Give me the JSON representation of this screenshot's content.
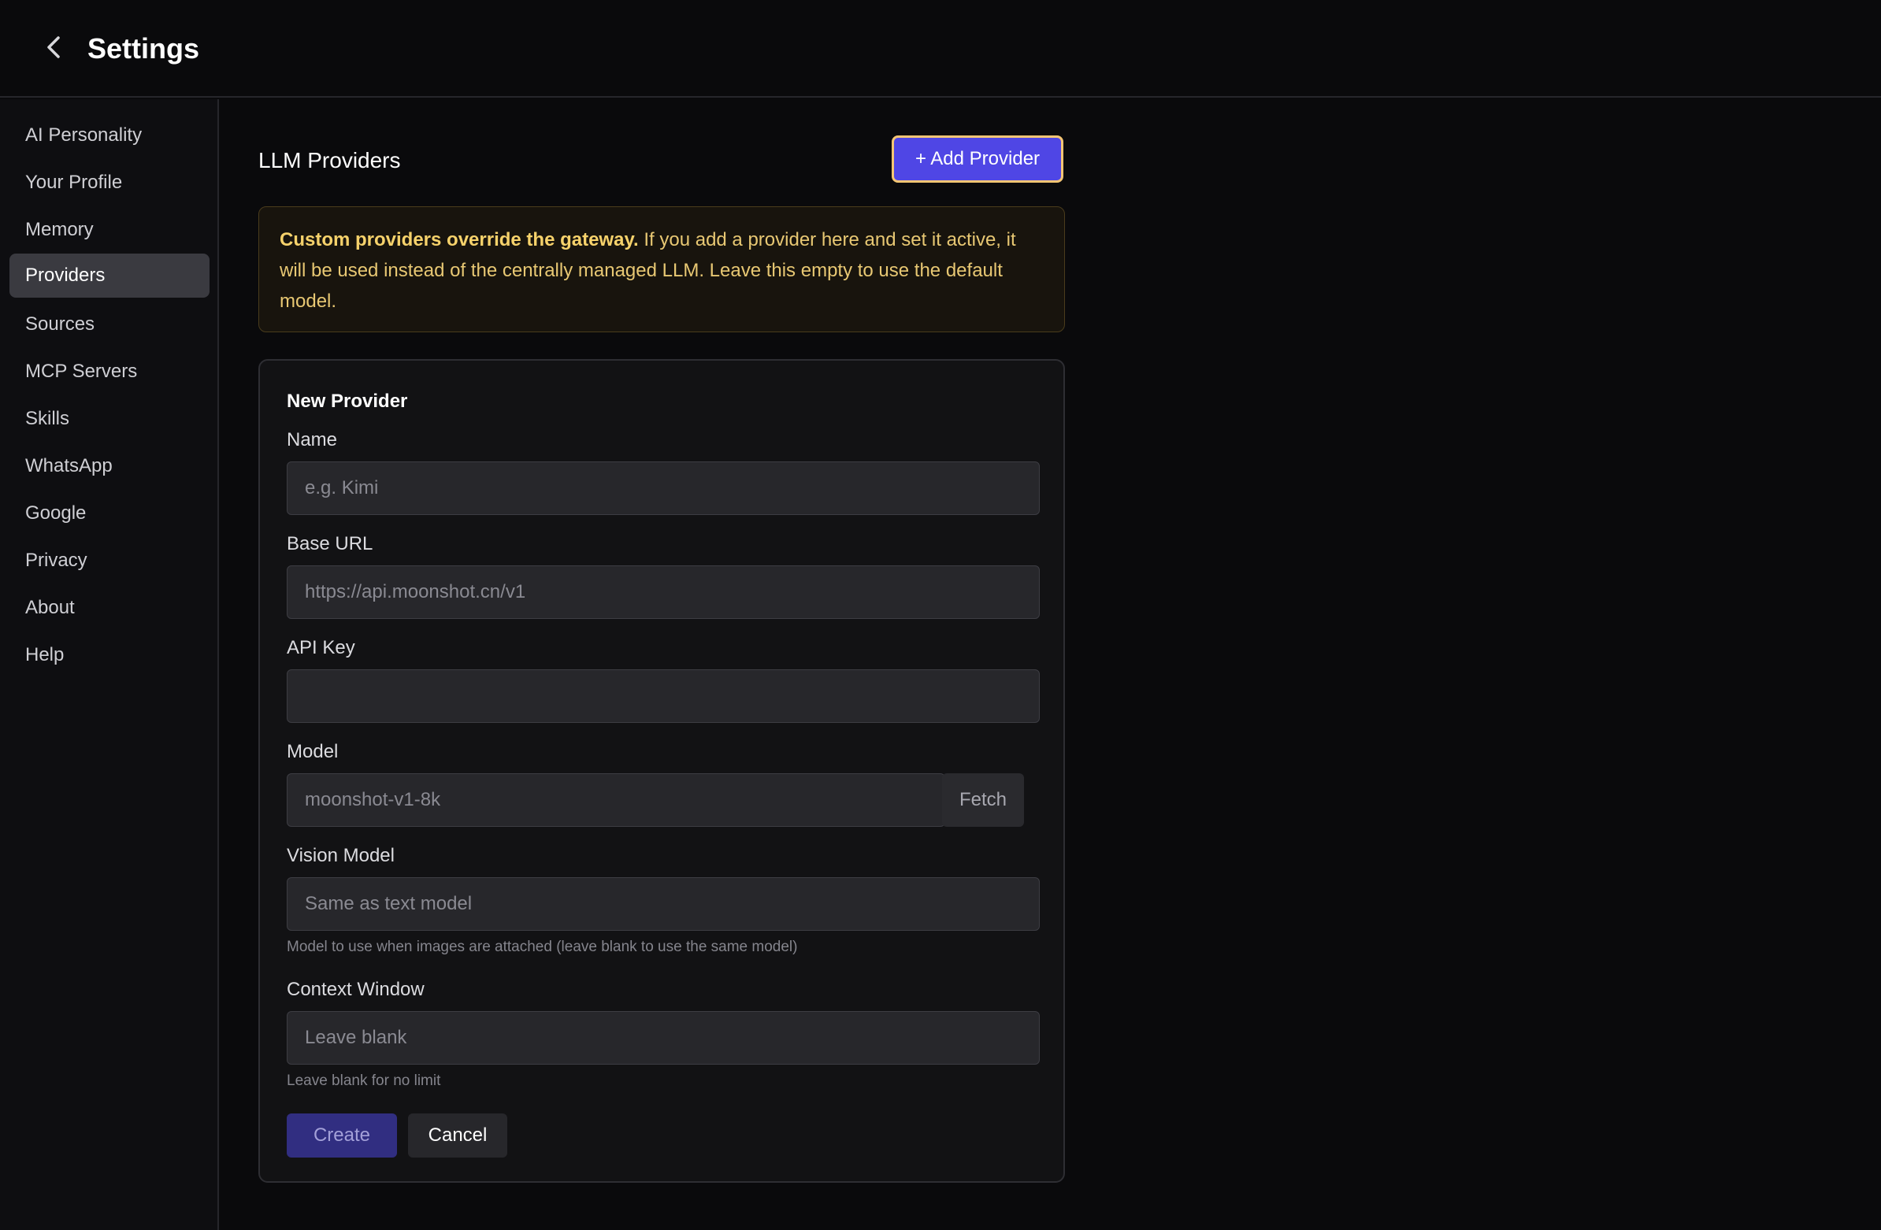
{
  "header": {
    "title": "Settings",
    "back_icon": "chevron-left-icon"
  },
  "sidebar": {
    "items": [
      {
        "label": "AI Personality",
        "active": false
      },
      {
        "label": "Your Profile",
        "active": false
      },
      {
        "label": "Memory",
        "active": false
      },
      {
        "label": "Providers",
        "active": true
      },
      {
        "label": "Sources",
        "active": false
      },
      {
        "label": "MCP Servers",
        "active": false
      },
      {
        "label": "Skills",
        "active": false
      },
      {
        "label": "WhatsApp",
        "active": false
      },
      {
        "label": "Google",
        "active": false
      },
      {
        "label": "Privacy",
        "active": false
      },
      {
        "label": "About",
        "active": false
      },
      {
        "label": "Help",
        "active": false
      }
    ]
  },
  "main": {
    "section_title": "LLM Providers",
    "add_button_label": "+ Add Provider",
    "notice": {
      "bold": "Custom providers override the gateway.",
      "text": " If you add a provider here and set it active, it will be used instead of the centrally managed LLM. Leave this empty to use the default model."
    },
    "form": {
      "title": "New Provider",
      "name": {
        "label": "Name",
        "placeholder": "e.g. Kimi",
        "value": ""
      },
      "base_url": {
        "label": "Base URL",
        "placeholder": "https://api.moonshot.cn/v1",
        "value": ""
      },
      "api_key": {
        "label": "API Key",
        "placeholder": "",
        "value": ""
      },
      "model": {
        "label": "Model",
        "placeholder": "moonshot-v1-8k",
        "value": "",
        "fetch_label": "Fetch"
      },
      "vision_model": {
        "label": "Vision Model",
        "placeholder": "Same as text model",
        "value": "",
        "hint": "Model to use when images are attached (leave blank to use the same model)"
      },
      "context_window": {
        "label": "Context Window",
        "placeholder": "Leave blank",
        "value": "",
        "hint": "Leave blank for no limit"
      },
      "create_label": "Create",
      "cancel_label": "Cancel"
    }
  },
  "colors": {
    "accent": "#4f46e5",
    "focus_ring": "#f5c674",
    "notice_text": "#e8c873",
    "background": "#0a0a0c"
  }
}
